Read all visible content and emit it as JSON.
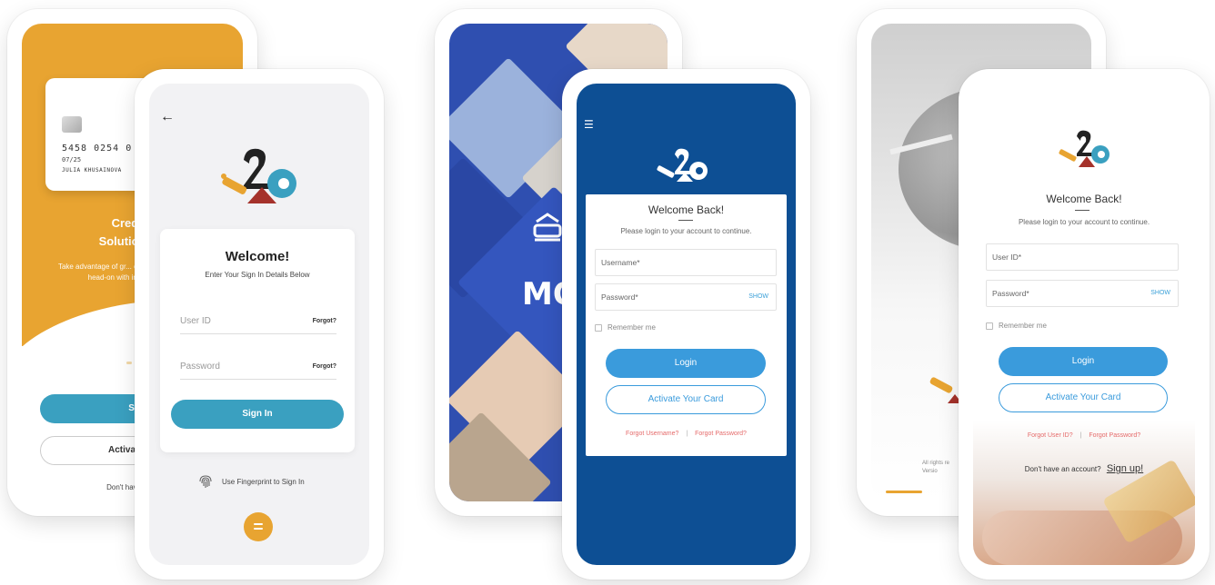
{
  "colors": {
    "orange": "#e8a431",
    "teal": "#3aa0c0",
    "navy": "#0d4f94",
    "blue_accent": "#3a9bdc",
    "link_red": "#e56a6a"
  },
  "phone1_back": {
    "card_number": "5458 0254 0",
    "card_expiry": "07/25",
    "card_holder": "JULIA KHUSAINOVA",
    "heading_line1": "Credit Car",
    "heading_line2": "Solutions With",
    "description": "Take advantage of gr... opportunities and m... head-on with inno... prod...",
    "signin_label": "Sig",
    "activate_label": "Activate / Re",
    "no_account_text": "Don't have an acc"
  },
  "phone1_front": {
    "back_icon": "arrow-left-icon",
    "title": "Welcome!",
    "subtitle": "Enter Your Sign In Details Below",
    "user_id_placeholder": "User ID",
    "password_placeholder": "Password",
    "forgot_label": "Forgot?",
    "signin_label": "Sign In",
    "fingerprint_text": "Use Fingerprint to Sign In"
  },
  "phone2_back": {
    "brand_text": "MO"
  },
  "phone2_front": {
    "title": "Welcome Back!",
    "subtitle": "Please login to your account to continue.",
    "username_placeholder": "Username*",
    "password_placeholder": "Password*",
    "show_label": "SHOW",
    "remember_label": "Remember me",
    "login_label": "Login",
    "activate_label": "Activate Your Card",
    "forgot_username": "Forgot Username?",
    "separator": "|",
    "forgot_password": "Forgot Password?"
  },
  "phone3_back": {
    "rights_line1": "All rights re",
    "rights_line2": "Versio"
  },
  "phone3_front": {
    "title": "Welcome Back!",
    "subtitle": "Please login to your account to continue.",
    "user_id_placeholder": "User ID*",
    "password_placeholder": "Password*",
    "show_label": "SHOW",
    "remember_label": "Remember me",
    "login_label": "Login",
    "activate_label": "Activate Your Card",
    "forgot_user_id": "Forgot User ID?",
    "separator": "|",
    "forgot_password": "Forgot Password?",
    "no_account_text": "Don't have an account?",
    "signup_label": "Sign up!"
  }
}
